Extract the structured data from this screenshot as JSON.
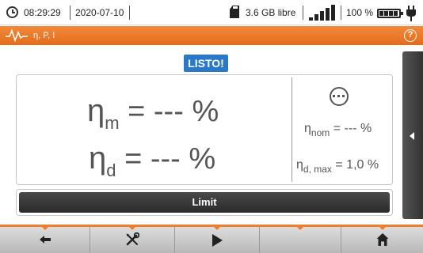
{
  "status_bar": {
    "time": "08:29:29",
    "date": "2020-07-10",
    "storage": "3.6 GB libre",
    "battery": "100 %",
    "icons": [
      "clock-icon",
      "sd-card-icon",
      "signal-icon",
      "battery-icon",
      "power-plug-icon"
    ]
  },
  "header": {
    "title": "η, P, I",
    "icons": [
      "waveform-icon",
      "help-icon"
    ]
  },
  "badge": "LISTO!",
  "measurement": {
    "eta_m": {
      "symbol": "η",
      "sub": "m",
      "eq": "=",
      "value": "---",
      "unit": "%"
    },
    "eta_d": {
      "symbol": "η",
      "sub": "d",
      "eq": "=",
      "value": "---",
      "unit": "%"
    },
    "eta_nom": {
      "symbol": "η",
      "sub": "nom",
      "eq": "=",
      "value": "---",
      "unit": "%"
    },
    "eta_dmax": {
      "symbol": "η",
      "sub": "d, max",
      "eq": "=",
      "value": "1,0",
      "unit": "%"
    },
    "indicator_icon": "result-pending-icon"
  },
  "limit_label": "Limit",
  "toolbar": {
    "buttons": [
      "back-icon",
      "tools-icon",
      "play-icon",
      "",
      "home-icon"
    ]
  },
  "colors": {
    "accent": "#ef7d2e",
    "badge": "#2979c8",
    "dark": "#2a2a2a"
  }
}
